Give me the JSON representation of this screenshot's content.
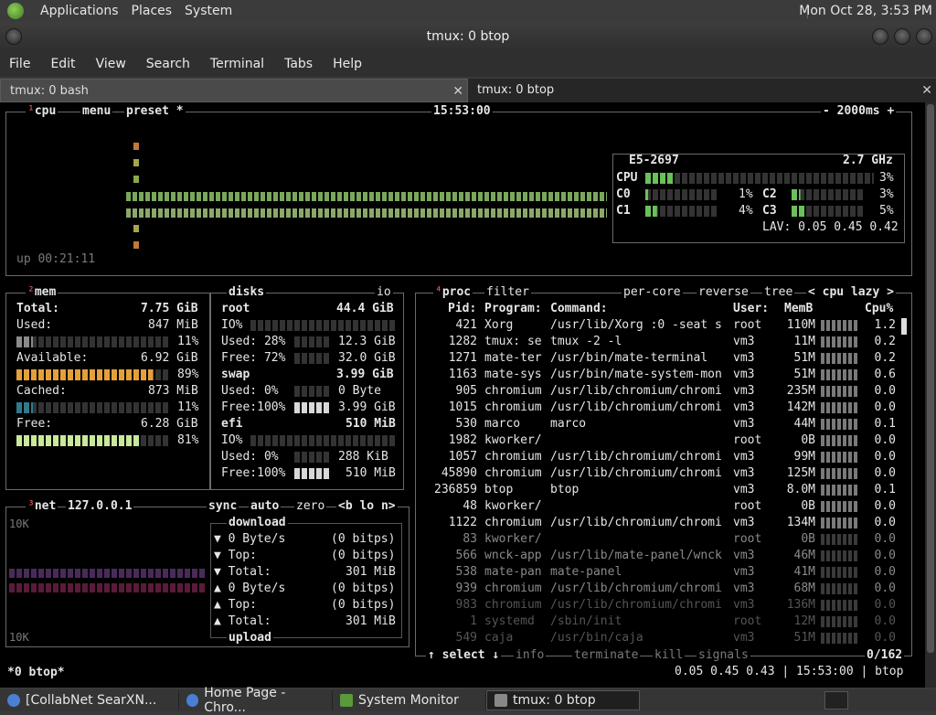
{
  "topbar": {
    "menus": [
      "Applications",
      "Places",
      "System"
    ],
    "clock": "Mon Oct 28,  3:53 PM"
  },
  "window": {
    "title": "tmux: 0 btop"
  },
  "menubar": [
    "File",
    "Edit",
    "View",
    "Search",
    "Terminal",
    "Tabs",
    "Help"
  ],
  "tabs": [
    {
      "label": "tmux: 0 bash"
    },
    {
      "label": "tmux: 0 btop"
    }
  ],
  "cpu": {
    "header": {
      "num": "¹",
      "name": "cpu",
      "menu": "menu",
      "preset": "preset *",
      "time": "15:53:00",
      "interval": "- 2000ms +"
    },
    "uptime": "up 00:21:11",
    "model": "E5-2697",
    "freq": "2.7 GHz",
    "total": {
      "label": "CPU",
      "pct": "3%",
      "value": 3
    },
    "cores": [
      {
        "label": "C0",
        "pct": "1%",
        "value": 1
      },
      {
        "label": "C1",
        "pct": "4%",
        "value": 4
      },
      {
        "label": "C2",
        "pct": "3%",
        "value": 3
      },
      {
        "label": "C3",
        "pct": "5%",
        "value": 5
      }
    ],
    "lav": "LAV: 0.05 0.45 0.42"
  },
  "mem": {
    "header": {
      "num": "²",
      "name": "mem"
    },
    "total": {
      "label": "Total:",
      "value": "7.75 GiB"
    },
    "used": {
      "label": "Used:",
      "value": "847 MiB",
      "pct": "11%",
      "fill": 11,
      "color": "#8a8a8a"
    },
    "available": {
      "label": "Available:",
      "value": "6.92 GiB",
      "pct": "89%",
      "fill": 89,
      "color": "#e3a03a"
    },
    "cached": {
      "label": "Cached:",
      "value": "873 MiB",
      "pct": "11%",
      "fill": 11,
      "color": "#2f7a8a"
    },
    "free": {
      "label": "Free:",
      "value": "6.28 GiB",
      "pct": "81%",
      "fill": 81,
      "color": "#c8e89a"
    }
  },
  "disks": {
    "header": {
      "name": "disks",
      "io": "io"
    },
    "root": {
      "name": "root",
      "size": "44.4 GiB",
      "io": "IO%",
      "used": "Used: 28%",
      "used_val": "12.3 GiB",
      "free": "Free: 72%",
      "free_val": "32.0 GiB"
    },
    "swap": {
      "name": "swap",
      "size": "3.99 GiB",
      "used": "Used:  0%",
      "used_val": "0 Byte",
      "free": "Free:100%",
      "free_val": "3.99 GiB"
    },
    "efi": {
      "name": "efi",
      "size": "510 MiB",
      "io": "IO%",
      "used": "Used:  0%",
      "used_val": "288 KiB",
      "free": "Free:100%",
      "free_val": "510 MiB"
    }
  },
  "net": {
    "header": {
      "num": "³",
      "name": "net",
      "ip": "127.0.0.1",
      "sync": "sync",
      "auto": "auto",
      "zero": "zero",
      "nav": "<b lo n>"
    },
    "scale_top": "10K",
    "scale_bottom": "10K",
    "download": {
      "title": "download",
      "rate": "▼ 0 Byte/s",
      "rate_bits": "(0 bitps)",
      "top": "▼ Top:",
      "top_bits": "(0 bitps)",
      "total": "▼ Total:",
      "total_val": "301 MiB"
    },
    "upload": {
      "title": "upload",
      "rate": "▲ 0 Byte/s",
      "rate_bits": "(0 bitps)",
      "top": "▲ Top:",
      "top_bits": "(0 bitps)",
      "total": "▲ Total:",
      "total_val": "301 MiB"
    }
  },
  "proc": {
    "header": {
      "num": "⁴",
      "name": "proc",
      "filter": "filter",
      "percore": "per-core",
      "reverse": "reverse",
      "tree": "tree",
      "sort": "< cpu lazy >"
    },
    "columns": {
      "pid": "Pid:",
      "program": "Program:",
      "command": "Command:",
      "user": "User:",
      "mem": "MemB",
      "cpu": "Cpu%"
    },
    "rows": [
      {
        "pid": "421",
        "program": "Xorg",
        "command": "/usr/lib/Xorg :0 -seat s",
        "user": "root",
        "mem": "110M",
        "cpu": "1.2"
      },
      {
        "pid": "1282",
        "program": "tmux: se",
        "command": "tmux -2 -l",
        "user": "vm3",
        "mem": "11M",
        "cpu": "0.2"
      },
      {
        "pid": "1271",
        "program": "mate-ter",
        "command": "/usr/bin/mate-terminal",
        "user": "vm3",
        "mem": "51M",
        "cpu": "0.2"
      },
      {
        "pid": "1163",
        "program": "mate-sys",
        "command": "/usr/bin/mate-system-mon",
        "user": "vm3",
        "mem": "51M",
        "cpu": "0.6"
      },
      {
        "pid": "905",
        "program": "chromium",
        "command": "/usr/lib/chromium/chromi",
        "user": "vm3",
        "mem": "235M",
        "cpu": "0.0"
      },
      {
        "pid": "1015",
        "program": "chromium",
        "command": "/usr/lib/chromium/chromi",
        "user": "vm3",
        "mem": "142M",
        "cpu": "0.0"
      },
      {
        "pid": "530",
        "program": "marco",
        "command": "marco",
        "user": "vm3",
        "mem": "44M",
        "cpu": "0.1"
      },
      {
        "pid": "1982",
        "program": "kworker/",
        "command": "",
        "user": "root",
        "mem": "0B",
        "cpu": "0.0"
      },
      {
        "pid": "1057",
        "program": "chromium",
        "command": "/usr/lib/chromium/chromi",
        "user": "vm3",
        "mem": "99M",
        "cpu": "0.0"
      },
      {
        "pid": "45890",
        "program": "chromium",
        "command": "/usr/lib/chromium/chromi",
        "user": "vm3",
        "mem": "125M",
        "cpu": "0.0"
      },
      {
        "pid": "236859",
        "program": "btop",
        "command": "btop",
        "user": "vm3",
        "mem": "8.0M",
        "cpu": "0.1"
      },
      {
        "pid": "48",
        "program": "kworker/",
        "command": "",
        "user": "root",
        "mem": "0B",
        "cpu": "0.0"
      },
      {
        "pid": "1122",
        "program": "chromium",
        "command": "/usr/lib/chromium/chromi",
        "user": "vm3",
        "mem": "134M",
        "cpu": "0.0"
      },
      {
        "pid": "83",
        "program": "kworker/",
        "command": "",
        "user": "root",
        "mem": "0B",
        "cpu": "0.0"
      },
      {
        "pid": "566",
        "program": "wnck-app",
        "command": "/usr/lib/mate-panel/wnck",
        "user": "vm3",
        "mem": "46M",
        "cpu": "0.0"
      },
      {
        "pid": "538",
        "program": "mate-pan",
        "command": "mate-panel",
        "user": "vm3",
        "mem": "41M",
        "cpu": "0.0"
      },
      {
        "pid": "939",
        "program": "chromium",
        "command": "/usr/lib/chromium/chromi",
        "user": "vm3",
        "mem": "68M",
        "cpu": "0.0"
      },
      {
        "pid": "983",
        "program": "chromium",
        "command": "/usr/lib/chromium/chromi",
        "user": "vm3",
        "mem": "136M",
        "cpu": "0.0"
      },
      {
        "pid": "1",
        "program": "systemd",
        "command": "/sbin/init",
        "user": "root",
        "mem": "12M",
        "cpu": "0.0"
      },
      {
        "pid": "549",
        "program": "caja",
        "command": "/usr/bin/caja",
        "user": "vm3",
        "mem": "51M",
        "cpu": "0.0"
      }
    ],
    "footer": {
      "select": "↑ select ↓",
      "info": "info",
      "terminate": "terminate",
      "kill": "kill",
      "signals": "signals",
      "count": "0/162"
    }
  },
  "statusline": {
    "left": "*0 btop*",
    "right": "0.05 0.45 0.43 | 15:53:00 | btop"
  },
  "taskbar": [
    {
      "label": "[CollabNet SearXN...",
      "icon": "chromium-icon",
      "color": "#4a7fd4"
    },
    {
      "label": "Home Page - Chro...",
      "icon": "chromium-icon",
      "color": "#4a7fd4"
    },
    {
      "label": "System Monitor",
      "icon": "system-monitor-icon",
      "color": "#5a9a3a"
    },
    {
      "label": "tmux: 0 btop",
      "icon": "terminal-icon",
      "color": "#888888"
    }
  ]
}
